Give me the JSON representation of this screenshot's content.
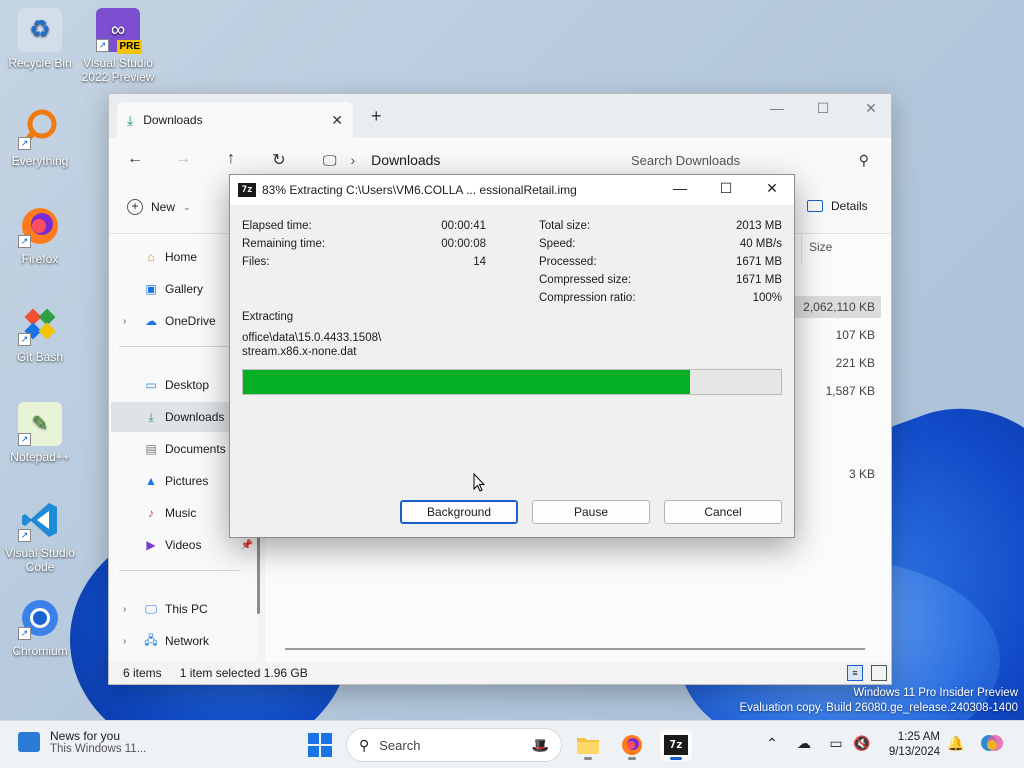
{
  "desktop": {
    "icons": [
      {
        "label": "Recycle Bin",
        "icon": "recycle-bin-icon"
      },
      {
        "label": "Visual Studio 2022 Preview",
        "icon": "visual-studio-icon",
        "badge": "PRE"
      },
      {
        "label": "Everything",
        "icon": "everything-search-icon"
      },
      {
        "label": "Firefox",
        "icon": "firefox-icon"
      },
      {
        "label": "Git Bash",
        "icon": "git-bash-icon"
      },
      {
        "label": "Notepad++",
        "icon": "notepad-plus-plus-icon"
      },
      {
        "label": "Visual Studio Code",
        "icon": "vscode-icon"
      },
      {
        "label": "Chromium",
        "icon": "chromium-icon"
      }
    ]
  },
  "explorer": {
    "tab_title": "Downloads",
    "breadcrumb": "Downloads",
    "search_placeholder": "Search Downloads",
    "new_label": "New",
    "details_label": "Details",
    "size_header": "Size",
    "sidebar": {
      "home": "Home",
      "gallery": "Gallery",
      "onedrive": "OneDrive",
      "desktop": "Desktop",
      "downloads": "Downloads",
      "documents": "Documents",
      "pictures": "Pictures",
      "music": "Music",
      "videos": "Videos",
      "this_pc": "This PC",
      "network": "Network"
    },
    "file_sizes": [
      "2,062,110 KB",
      "107 KB",
      "221 KB",
      "1,587 KB",
      "3 KB"
    ],
    "status": {
      "items": "6 items",
      "selected": "1 item selected  1.96 GB"
    }
  },
  "dialog": {
    "title": "83% Extracting C:\\Users\\VM6.COLLA ... essionalRetail.img",
    "app_icon_text": "7z",
    "left_stats": [
      {
        "label": "Elapsed time:",
        "value": "00:00:41"
      },
      {
        "label": "Remaining time:",
        "value": "00:00:08"
      },
      {
        "label": "Files:",
        "value": "14"
      }
    ],
    "right_stats": [
      {
        "label": "Total size:",
        "value": "2013 MB"
      },
      {
        "label": "Speed:",
        "value": "40 MB/s"
      },
      {
        "label": "Processed:",
        "value": "1671 MB"
      },
      {
        "label": "Compressed size:",
        "value": "1671 MB"
      },
      {
        "label": "Compression ratio:",
        "value": "100%"
      }
    ],
    "extracting_label": "Extracting",
    "current_path_line1": "office\\data\\15.0.4433.1508\\",
    "current_path_line2": "stream.x86.x-none.dat",
    "progress_percent": 83,
    "progress_color": "#06b025",
    "buttons": {
      "background": "Background",
      "pause": "Pause",
      "cancel": "Cancel"
    }
  },
  "watermark": {
    "line1": "Windows 11 Pro Insider Preview",
    "line2": "Evaluation copy. Build 26080.ge_release.240308-1400"
  },
  "taskbar": {
    "news_title": "News for you",
    "news_sub": "This Windows 11...",
    "search_label": "Search",
    "apps": [
      "file-explorer-icon",
      "firefox-icon",
      "7zip-icon"
    ],
    "seven_zip_text": "7z",
    "time": "1:25 AM",
    "date": "9/13/2024"
  }
}
